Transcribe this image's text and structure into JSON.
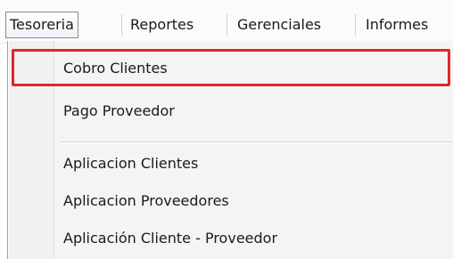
{
  "menubar": {
    "items": [
      {
        "label": "Tesoreria",
        "active": true
      },
      {
        "label": "Reportes",
        "active": false
      },
      {
        "label": "Gerenciales",
        "active": false
      },
      {
        "label": "Informes",
        "active": false
      }
    ]
  },
  "dropdown": {
    "items": [
      {
        "label": "Cobro Clientes",
        "highlighted": true
      },
      {
        "label": "Pago Proveedor",
        "highlighted": false
      },
      {
        "label": "Aplicacion Clientes",
        "highlighted": false
      },
      {
        "label": "Aplicacion Proveedores",
        "highlighted": false
      },
      {
        "label": "Aplicación Cliente - Proveedor",
        "highlighted": false
      }
    ],
    "highlight_color": "#e0262b"
  }
}
